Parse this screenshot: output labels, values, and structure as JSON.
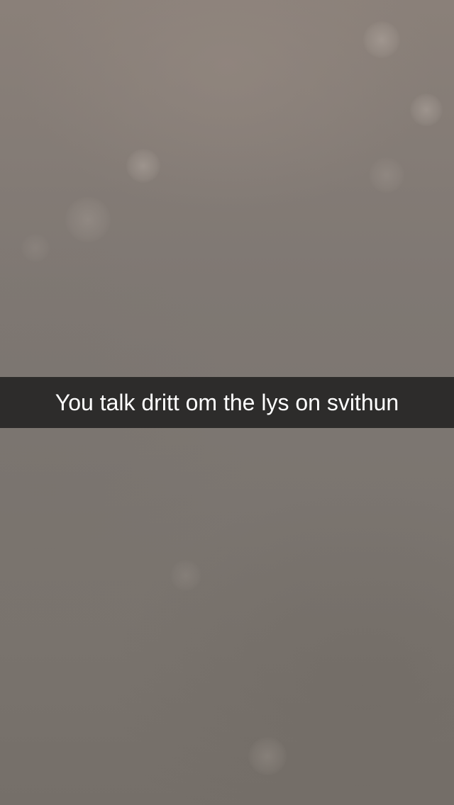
{
  "caption": {
    "text": "You talk dritt om the lys on svithun"
  },
  "colors": {
    "background": "#7f7873",
    "caption_bar": "#1c1c1c",
    "caption_text": "#ffffff"
  }
}
